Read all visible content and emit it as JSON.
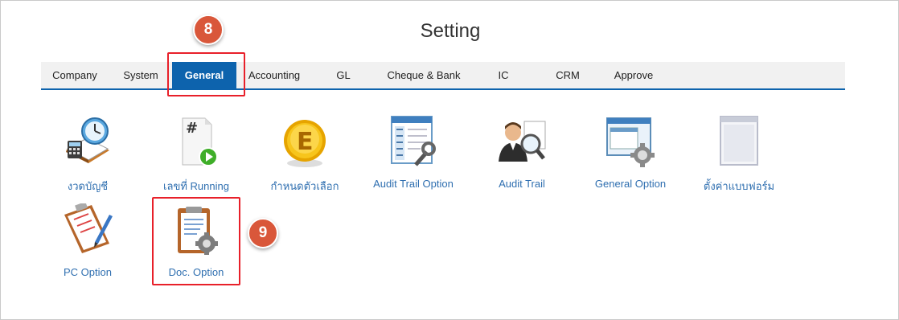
{
  "page": {
    "title": "Setting"
  },
  "tabs": [
    {
      "label": "Company"
    },
    {
      "label": "System"
    },
    {
      "label": "General",
      "active": true
    },
    {
      "label": "Accounting"
    },
    {
      "label": "GL"
    },
    {
      "label": "Cheque & Bank"
    },
    {
      "label": "IC"
    },
    {
      "label": "CRM"
    },
    {
      "label": "Approve"
    }
  ],
  "badges": {
    "step_8": "8",
    "step_9": "9"
  },
  "items": [
    {
      "label": "งวดบัญชี",
      "icon": "calendar-clock-calculator-icon"
    },
    {
      "label": "เลขที่ Running",
      "icon": "running-number-document-icon"
    },
    {
      "label": "กำหนดตัวเลือก",
      "icon": "e-coin-icon"
    },
    {
      "label": "Audit Trail Option",
      "icon": "audit-trail-option-icon"
    },
    {
      "label": "Audit Trail",
      "icon": "user-magnifier-icon"
    },
    {
      "label": "General Option",
      "icon": "window-gear-icon"
    },
    {
      "label": "ตั้งค่าแบบฟอร์ม",
      "icon": "form-window-icon"
    },
    {
      "label": "PC Option",
      "icon": "clipboard-pen-icon"
    },
    {
      "label": "Doc. Option",
      "icon": "clipboard-gear-icon"
    }
  ],
  "colors": {
    "accent": "#0d63ad",
    "highlight": "#e8202a",
    "badge": "#d9573a",
    "link": "#2f6fb0"
  }
}
